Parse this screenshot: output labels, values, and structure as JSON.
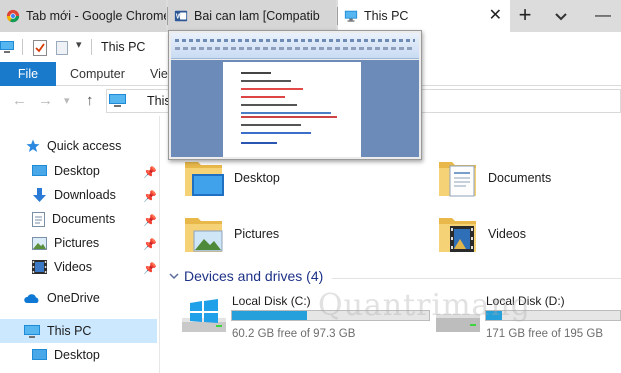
{
  "browser": {
    "tabs": [
      {
        "title": "Tab mới - Google Chrome",
        "icon": "chrome-icon"
      },
      {
        "title": "Bai can lam [Compatib",
        "icon": "word-icon"
      },
      {
        "title": "This PC",
        "icon": "this-pc-icon",
        "close": "✕"
      }
    ],
    "new_tab": "+"
  },
  "explorer": {
    "title": "This PC",
    "ribbon_tabs": [
      "File",
      "Computer",
      "Viev"
    ],
    "address": "This",
    "accent_color": "#1979ca",
    "nav": {
      "quick_access": "Quick access",
      "items": [
        {
          "label": "Desktop",
          "icon": "desktop-icon"
        },
        {
          "label": "Downloads",
          "icon": "download-icon"
        },
        {
          "label": "Documents",
          "icon": "documents-icon"
        },
        {
          "label": "Pictures",
          "icon": "pictures-icon"
        },
        {
          "label": "Videos",
          "icon": "videos-icon"
        }
      ],
      "onedrive": "OneDrive",
      "this_pc": "This PC",
      "this_pc_desktop": "Desktop"
    },
    "folders": [
      {
        "label": "Desktop",
        "icon": "desktop-folder-icon"
      },
      {
        "label": "Documents",
        "icon": "documents-folder-icon"
      },
      {
        "label": "Pictures",
        "icon": "pictures-folder-icon"
      },
      {
        "label": "Videos",
        "icon": "videos-folder-icon"
      }
    ],
    "devices_header": "Devices and drives (4)",
    "drives": [
      {
        "name": "Local Disk (C:)",
        "free_text": "60.2 GB free of 97.3 GB",
        "used_fraction": 0.38
      },
      {
        "name": "Local Disk (D:)",
        "free_text": "171 GB free of 195 GB",
        "used_fraction": 0.12
      }
    ]
  },
  "watermark": "Quantrimang"
}
